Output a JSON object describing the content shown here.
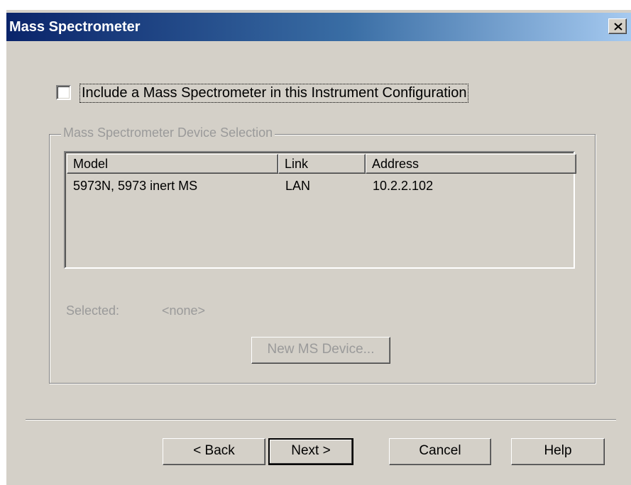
{
  "window": {
    "title": "Mass Spectrometer",
    "close_symbol": "×"
  },
  "include_checkbox": {
    "checked": false,
    "label": "Include a Mass Spectrometer in this Instrument Configuration"
  },
  "device_group": {
    "legend": "Mass Spectrometer Device Selection",
    "columns": [
      "Model",
      "Link",
      "Address"
    ],
    "rows": [
      {
        "model": "5973N, 5973 inert MS",
        "link": "LAN",
        "address": "10.2.2.102"
      }
    ],
    "selected_label": "Selected:",
    "selected_value": "<none>",
    "new_device_label": "New MS Device..."
  },
  "buttons": {
    "back": "< Back",
    "next": "Next >",
    "cancel": "Cancel",
    "help": "Help"
  }
}
